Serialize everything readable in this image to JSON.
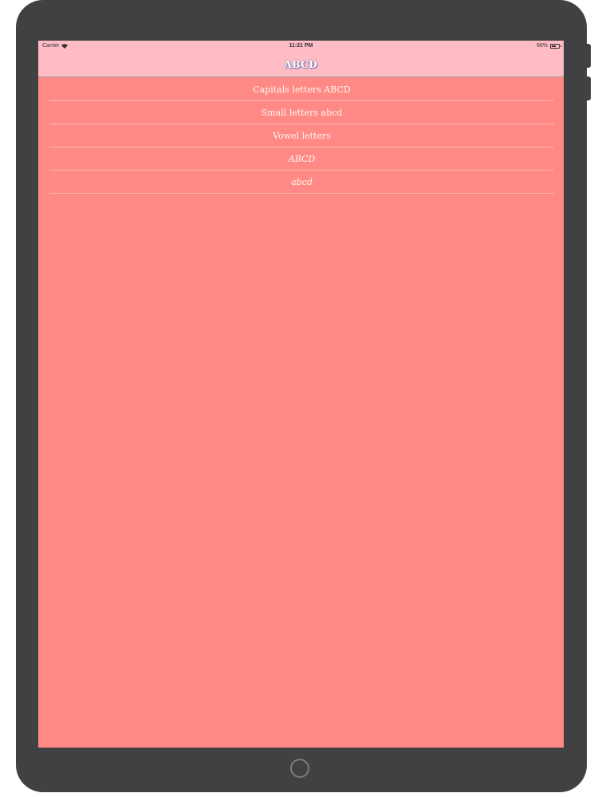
{
  "statusbar": {
    "carrier": "Carrier",
    "time": "11:21 PM",
    "battery_text": "66%",
    "battery_level": 0.66
  },
  "navbar": {
    "title": "ABCD"
  },
  "list": {
    "items": [
      {
        "label": "Capitals letters ABCD",
        "italic": false
      },
      {
        "label": "Small letters abcd",
        "italic": false
      },
      {
        "label": "Vowel letters",
        "italic": false
      },
      {
        "label": "ABCD",
        "italic": true
      },
      {
        "label": "abcd",
        "italic": true
      }
    ]
  },
  "colors": {
    "screen_bg": "#ff8a85",
    "bar_bg": "#ffbcc4",
    "device": "#414042"
  }
}
